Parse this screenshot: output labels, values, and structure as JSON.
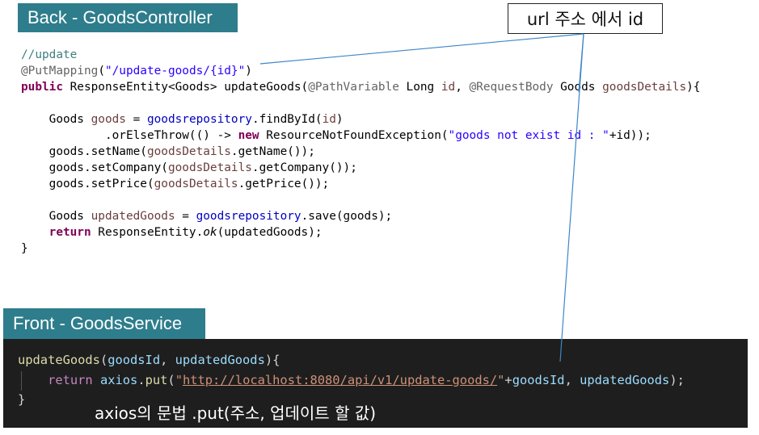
{
  "labels": {
    "back": "Back - GoodsController",
    "front": "Front - GoodsService",
    "callout": "url 주소 에서 id",
    "syntax_note": "axios의 문법 .put(주소, 업데이트 할 값)"
  },
  "java": {
    "comment": "//update",
    "put_mapping": "@PutMapping",
    "open_paren": "(",
    "mapping_path": "\"/update-goods/{id}\"",
    "close_paren": ")",
    "kw_public": "public",
    "signature_a": " ResponseEntity<Goods> updateGoods(",
    "path_var_anno": "@PathVariable",
    "long_id_type": " Long ",
    "param_id": "id",
    "comma1": ", ",
    "request_body_anno": "@RequestBody",
    "goods_type": " Goods ",
    "param_details": "goodsDetails",
    "sig_end": "){",
    "goods_decl": "    Goods ",
    "var_goods": "goods",
    "eq": " = ",
    "repo": "goodsrepository",
    "find_by_id": ".findById(",
    "find_by_id_arg": "id",
    "find_close": ")",
    "or_else_a": "            .orElseThrow(() -> ",
    "kw_new": "new",
    "exception_call": " ResourceNotFoundException(",
    "exception_msg": "\"goods not exist id : \"",
    "exception_tail": "+id));",
    "set_name_a": "    goods.setName(",
    "details1": "goodsDetails",
    "set_name_b": ".getName());",
    "set_company_a": "    goods.setCompany(",
    "details2": "goodsDetails",
    "set_company_b": ".getCompany());",
    "set_price_a": "    goods.setPrice(",
    "details3": "goodsDetails",
    "set_price_b": ".getPrice());",
    "updated_decl": "    Goods ",
    "var_updated": "updatedGoods",
    "eq2": " = ",
    "repo2": "goodsrepository",
    "save_call": ".save(goods);",
    "return_indent": "    ",
    "kw_return": "return",
    "response_ok_a": " ResponseEntity.",
    "ok": "ok",
    "response_ok_b": "(updatedGoods);",
    "close_brace": "}"
  },
  "js": {
    "fn_name": "updateGoods",
    "open": "(",
    "param1": "goodsId",
    "comma": ", ",
    "param2": "updatedGoods",
    "sig_end": "){",
    "indent": "    ",
    "kw_return": "return",
    "space": " ",
    "axios": "axios",
    "dot": ".",
    "put": "put",
    "open2": "(",
    "quote_open": "\"",
    "url": "http://localhost:8080/api/v1/update-goods/",
    "quote_close": "\"",
    "plus": "+",
    "arg1": "goodsId",
    "comma2": ", ",
    "arg2": "updatedGoods",
    "end": ");",
    "close_brace": "}"
  },
  "colors": {
    "label_bg": "#2e7d8c",
    "panel_bg": "#1e1e1e",
    "pointer_line": "#3c86c8"
  }
}
